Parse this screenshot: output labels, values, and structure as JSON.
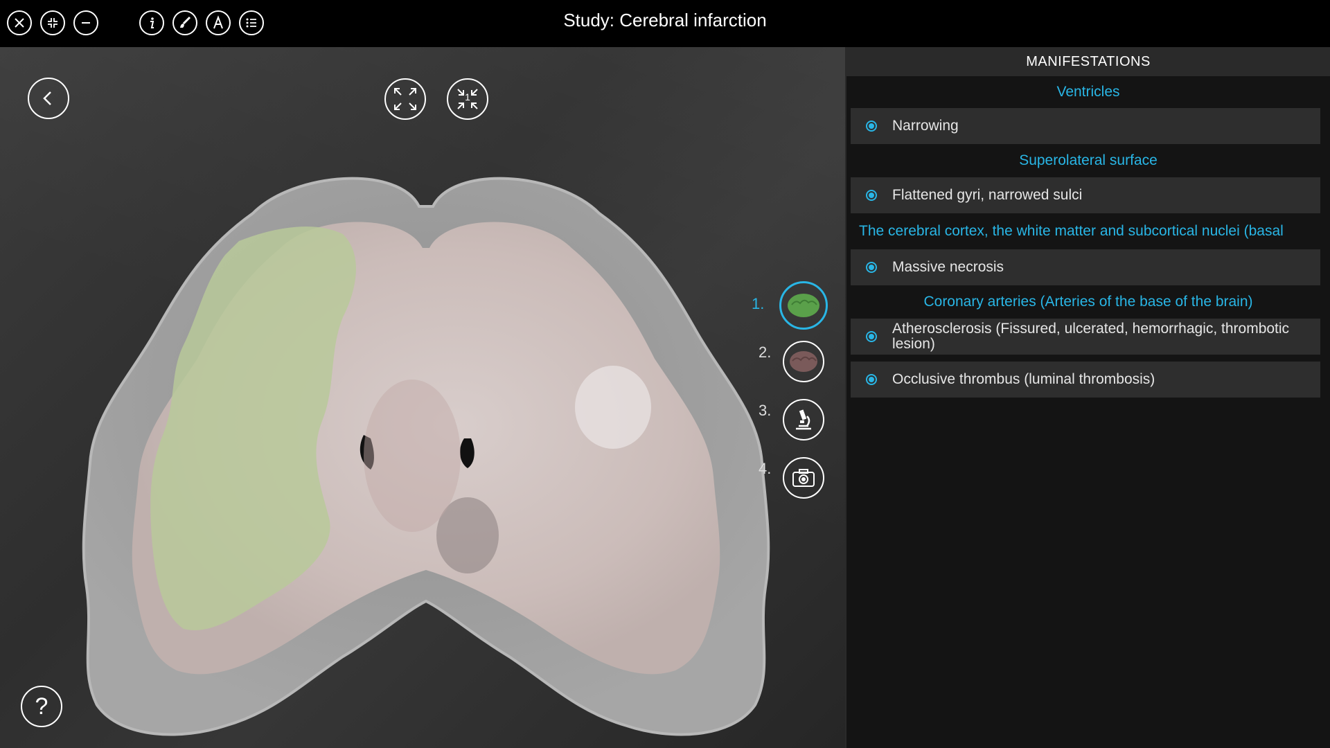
{
  "window": {
    "title": "Study: Cerebral infarction"
  },
  "toolbar": {
    "icons": [
      "close-icon",
      "collapse-icon",
      "minimize-icon",
      "info-icon",
      "brush-icon",
      "annotation-icon",
      "list-icon"
    ]
  },
  "viewer": {
    "icons": [
      "back-icon",
      "expand-icon",
      "reset-view-icon",
      "help-icon"
    ],
    "reset_view_badge": "1",
    "steps": [
      {
        "number": "1.",
        "icon": "brain-green-icon",
        "active": true
      },
      {
        "number": "2.",
        "icon": "brain-red-icon",
        "active": false
      },
      {
        "number": "3.",
        "icon": "microscope-icon",
        "active": false
      },
      {
        "number": "4.",
        "icon": "camera-icon",
        "active": false
      }
    ]
  },
  "panel": {
    "header": "MANIFESTATIONS",
    "sections": [
      {
        "title": "Ventricles",
        "items": [
          "Narrowing"
        ]
      },
      {
        "title": "Superolateral surface",
        "items": [
          "Flattened gyri, narrowed sulci"
        ]
      },
      {
        "title": "The cerebral cortex, the white matter and subcortical nuclei (basal",
        "items": [
          "Massive necrosis"
        ]
      },
      {
        "title": "Coronary arteries (Arteries of the base of the brain)",
        "items": [
          "Atherosclerosis (Fissured, ulcerated, hemorrhagic, thrombotic lesion)",
          "Occlusive thrombus (luminal thrombosis)"
        ]
      }
    ]
  },
  "colors": {
    "accent": "#29b6e6",
    "panel_bg": "#141414",
    "item_bg": "#2e2e2e",
    "necrosis": "#b9c99a"
  }
}
